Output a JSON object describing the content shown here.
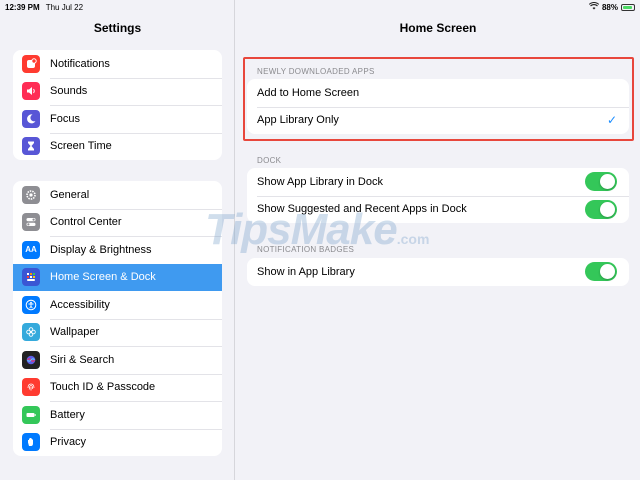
{
  "status_bar": {
    "time": "12:39 PM",
    "date": "Thu Jul 22",
    "battery": "88%"
  },
  "sidebar": {
    "title": "Settings",
    "group1": [
      {
        "label": "Notifications",
        "icon": "notifications-icon",
        "color": "#ff3b30"
      },
      {
        "label": "Sounds",
        "icon": "sounds-icon",
        "color": "#ff2d55"
      },
      {
        "label": "Focus",
        "icon": "focus-moon-icon",
        "color": "#5856d6"
      },
      {
        "label": "Screen Time",
        "icon": "hourglass-icon",
        "color": "#5856d6"
      }
    ],
    "group2": [
      {
        "label": "General",
        "icon": "gear-icon",
        "color": "#8e8e93"
      },
      {
        "label": "Control Center",
        "icon": "toggles-icon",
        "color": "#8e8e93"
      },
      {
        "label": "Display & Brightness",
        "icon": "aa-icon",
        "color": "#007aff"
      },
      {
        "label": "Home Screen & Dock",
        "icon": "app-grid-icon",
        "color": "#3a56d4",
        "selected": true
      },
      {
        "label": "Accessibility",
        "icon": "accessibility-icon",
        "color": "#007aff"
      },
      {
        "label": "Wallpaper",
        "icon": "flower-icon",
        "color": "#35aadc"
      },
      {
        "label": "Siri & Search",
        "icon": "siri-icon",
        "color": "#222222"
      },
      {
        "label": "Touch ID & Passcode",
        "icon": "fingerprint-icon",
        "color": "#ff3b30"
      },
      {
        "label": "Battery",
        "icon": "battery-icon",
        "color": "#34c759"
      },
      {
        "label": "Privacy",
        "icon": "hand-icon",
        "color": "#007aff"
      }
    ]
  },
  "detail": {
    "title": "Home Screen",
    "sections": {
      "newly_downloaded": {
        "header": "NEWLY DOWNLOADED APPS",
        "options": [
          {
            "label": "Add to Home Screen",
            "checked": false
          },
          {
            "label": "App Library Only",
            "checked": true
          }
        ]
      },
      "dock": {
        "header": "DOCK",
        "rows": [
          {
            "label": "Show App Library in Dock",
            "on": true
          },
          {
            "label": "Show Suggested and Recent Apps in Dock",
            "on": true
          }
        ]
      },
      "badges": {
        "header": "NOTIFICATION BADGES",
        "rows": [
          {
            "label": "Show in App Library",
            "on": true
          }
        ]
      }
    },
    "check_glyph": "✓"
  },
  "watermark": {
    "text": "TipsMake",
    "suffix": ".com"
  },
  "colors": {
    "accent": "#3f9af0",
    "toggle_on": "#34c759",
    "highlight": "#e8473c"
  }
}
